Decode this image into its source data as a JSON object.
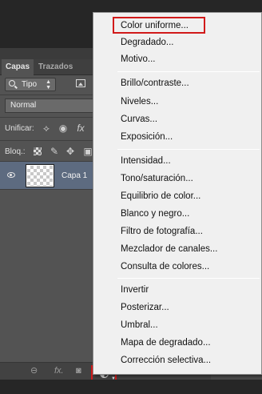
{
  "layers_panel": {
    "tabs": [
      {
        "label": "Capas",
        "active": true
      },
      {
        "label": "Trazados",
        "active": false
      }
    ],
    "filter": {
      "label": "Tipo",
      "icon": "search-icon"
    },
    "blend_mode": {
      "value": "Normal"
    },
    "unify_label": "Unificar:",
    "lock_label": "Bloq.:",
    "layers": [
      {
        "name": "Capa 1",
        "visible": true,
        "selected": true
      }
    ],
    "bottom_icons": [
      "link-icon",
      "fx-icon",
      "mask-icon",
      "adjustment-layer-icon"
    ],
    "fx_label": "fx."
  },
  "adjustment_menu": {
    "highlighted_item": "Color uniforme...",
    "highlight_color": "#d11a1a",
    "groups": [
      [
        "Color uniforme...",
        "Degradado...",
        "Motivo..."
      ],
      [
        "Brillo/contraste...",
        "Niveles...",
        "Curvas...",
        "Exposición..."
      ],
      [
        "Intensidad...",
        "Tono/saturación...",
        "Equilibrio de color...",
        "Blanco y negro...",
        "Filtro de fotografía...",
        "Mezclador de canales...",
        "Consulta de colores..."
      ],
      [
        "Invertir",
        "Posterizar...",
        "Umbral...",
        "Mapa de degradado...",
        "Corrección selectiva..."
      ]
    ]
  },
  "colors": {
    "panel_bg": "#535353",
    "selected_layer": "#5d6b80",
    "menu_bg": "#f0f0f0"
  }
}
